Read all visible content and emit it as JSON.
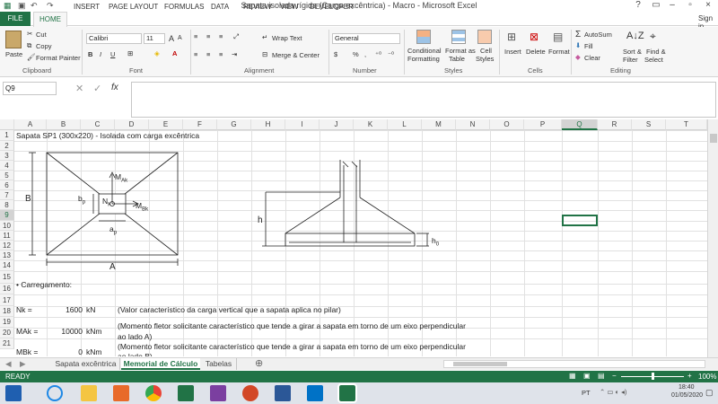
{
  "window": {
    "title": "Sapata isolada rígida (Carga excêntrica) - Macro - Microsoft Excel",
    "help": "?",
    "min": "–",
    "max": "▫",
    "close": "×",
    "signin": "Sign in"
  },
  "ribbon_tabs": [
    "FILE",
    "HOME",
    "INSERT",
    "PAGE LAYOUT",
    "FORMULAS",
    "DATA",
    "REVIEW",
    "VIEW",
    "DEVELOPER"
  ],
  "clipboard": {
    "paste": "Paste",
    "cut": "Cut",
    "copy": "Copy",
    "format_painter": "Format Painter",
    "group": "Clipboard"
  },
  "font": {
    "name": "Calibri",
    "size": "11",
    "bold": "B",
    "italic": "I",
    "underline": "U",
    "grow": "A",
    "shrink": "A",
    "group": "Font"
  },
  "alignment": {
    "wrap": "Wrap Text",
    "merge": "Merge & Center",
    "group": "Alignment"
  },
  "number": {
    "format": "General",
    "currency": "$",
    "percent": "%",
    "comma": ",",
    "group": "Number"
  },
  "styles": {
    "cond": "Conditional",
    "cond2": "Formatting",
    "table": "Format as",
    "table2": "Table",
    "cell": "Cell",
    "cell2": "Styles",
    "group": "Styles"
  },
  "cells": {
    "insert": "Insert",
    "delete": "Delete",
    "format": "Format",
    "group": "Cells"
  },
  "editing": {
    "autosum": "AutoSum",
    "fill": "Fill",
    "clear": "Clear",
    "sort": "Sort &",
    "sort2": "Filter",
    "find": "Find &",
    "find2": "Select",
    "group": "Editing"
  },
  "formula_bar": {
    "name_box": "Q9",
    "fx": "fx",
    "formula": ""
  },
  "columns": [
    "A",
    "B",
    "C",
    "D",
    "E",
    "F",
    "G",
    "H",
    "I",
    "J",
    "K",
    "L",
    "M",
    "N",
    "O",
    "P",
    "Q",
    "R",
    "S",
    "T"
  ],
  "rows": [
    "1",
    "2",
    "3",
    "4",
    "5",
    "6",
    "7",
    "8",
    "9",
    "10",
    "11",
    "12",
    "13",
    "14",
    "15",
    "16",
    "17",
    "18",
    "19",
    "20",
    "21"
  ],
  "cells_text": {
    "r1": "Sapata SP1 (300x220) - Isolada com carga excêntrica",
    "r15": "• Carregamento:",
    "nk_label": "Nk =",
    "nk_val": "1600",
    "nk_unit": "kN",
    "nk_desc": "(Valor característico da carga vertical que a sapata aplica no pilar)",
    "mak_label": "MAk =",
    "mak_val": "10000",
    "mak_unit": "kNm",
    "mak_desc1": "(Momento fletor solicitante característico que tende a girar a sapata em torno de um eixo perpendicular",
    "mak_desc2": "ao lado A)",
    "mbk_label": "MBk =",
    "mbk_val": "0",
    "mbk_unit": "kNm",
    "mbk_desc1": "(Momento fletor solicitante característico que tende a girar a sapata em torno de um eixo perpendicular",
    "mbk_desc2": "ao lado B)"
  },
  "drawing": {
    "B": "B",
    "A": "A",
    "bp": "b",
    "bp_sub": "p",
    "ap": "a",
    "ap_sub": "p",
    "nk": "N",
    "nk_sub": "K",
    "mak": "M",
    "mak_sub": "Ak",
    "mbk": "M",
    "mbk_sub": "Bk",
    "h": "h",
    "h0": "h",
    "h0_sub": "0"
  },
  "sheets": [
    "Sapata excêntrica",
    "Memorial de Cálculo",
    "Tabelas"
  ],
  "active_sheet": "Memorial de Cálculo",
  "add_sheet": "⊕",
  "status": {
    "ready": "READY",
    "zoom": "100%"
  },
  "taskbar": {
    "lang": "PT",
    "time": "18:40",
    "date": "01/05/2020"
  },
  "colors": {
    "excel_green": "#217346"
  }
}
